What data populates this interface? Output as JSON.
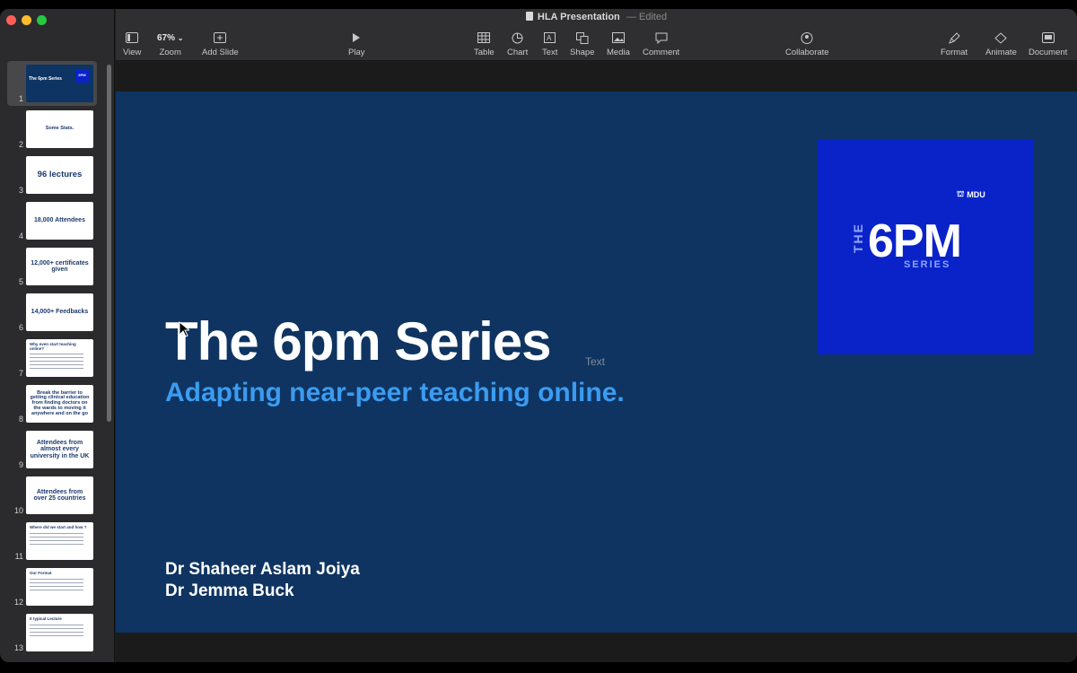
{
  "window": {
    "title": "HLA Presentation",
    "status": "Edited"
  },
  "toolbar": {
    "view": "View",
    "zoom_value": "67%",
    "zoom": "Zoom",
    "add_slide": "Add Slide",
    "play": "Play",
    "table": "Table",
    "chart": "Chart",
    "text": "Text",
    "shape": "Shape",
    "media": "Media",
    "comment": "Comment",
    "collaborate": "Collaborate",
    "format": "Format",
    "animate": "Animate",
    "document": "Document"
  },
  "navigator": {
    "slides": [
      {
        "num": "1",
        "text": "The 6pm Series"
      },
      {
        "num": "2",
        "text": "Some Stats."
      },
      {
        "num": "3",
        "text": "96 lectures"
      },
      {
        "num": "4",
        "text": "18,000 Attendees"
      },
      {
        "num": "5",
        "text": "12,000+ certificates given"
      },
      {
        "num": "6",
        "text": "14,000+ Feedbacks"
      },
      {
        "num": "7",
        "text": "Why even start teaching online?"
      },
      {
        "num": "8",
        "text": "Break the barrier to getting clinical education from finding doctors on the wards to moving it anywhere and on the go"
      },
      {
        "num": "9",
        "text": "Attendees from almost every university in the UK"
      },
      {
        "num": "10",
        "text": "Attendees from over 25 countries"
      },
      {
        "num": "11",
        "text": "Where did we start and how ?"
      },
      {
        "num": "12",
        "text": "Our Format"
      },
      {
        "num": "13",
        "text": "It typical Lecture"
      }
    ]
  },
  "slide": {
    "title": "The 6pm Series",
    "placeholder": "Text",
    "subtitle": "Adapting near-peer teaching online.",
    "authors": [
      "Dr Shaheer Aslam Joiya",
      "Dr Jemma Buck"
    ],
    "logo": {
      "mdu": "MDU",
      "the": "THE",
      "main": "6PM",
      "series": "SERIES"
    }
  },
  "colors": {
    "slide_bg": "#0f3461",
    "subtitle": "#3b9cf0",
    "logo_bg": "#0a23c9"
  }
}
